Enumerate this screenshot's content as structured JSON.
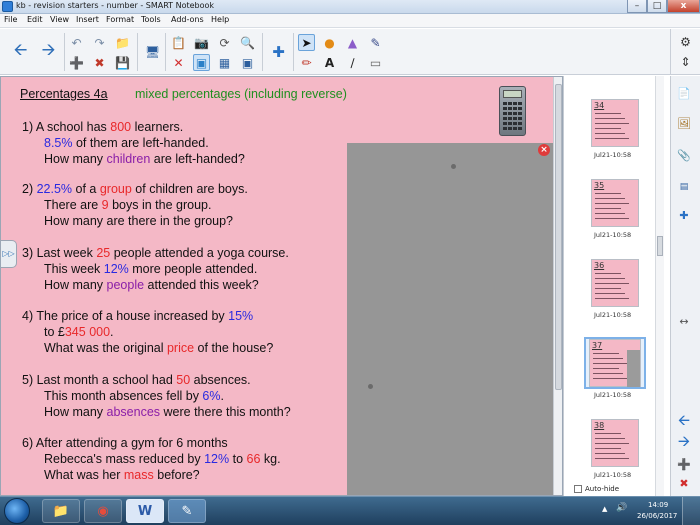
{
  "window": {
    "title": "kb - revision starters - number - SMART Notebook",
    "min_label": "–",
    "max_label": "□",
    "close_label": "x"
  },
  "menu": [
    "File",
    "Edit",
    "View",
    "Insert",
    "Format",
    "Tools",
    "Add-ons",
    "Help"
  ],
  "page": {
    "heading": "Percentages 4a",
    "subheading": "mixed percentages (including reverse)",
    "questions": [
      {
        "lines": [
          [
            {
              "t": "1)  A school has ",
              "c": ""
            },
            {
              "t": "800",
              "c": "red"
            },
            {
              "t": " learners.",
              "c": ""
            }
          ],
          [
            {
              "t": "8.5%",
              "c": "blue"
            },
            {
              "t": " of them are left-handed.",
              "c": ""
            }
          ],
          [
            {
              "t": "How many ",
              "c": ""
            },
            {
              "t": "children",
              "c": "purple"
            },
            {
              "t": " are left-handed?",
              "c": ""
            }
          ]
        ]
      },
      {
        "lines": [
          [
            {
              "t": "2)  ",
              "c": ""
            },
            {
              "t": "22.5%",
              "c": "blue"
            },
            {
              "t": " of a ",
              "c": ""
            },
            {
              "t": "group",
              "c": "red"
            },
            {
              "t": " of children are boys.",
              "c": ""
            }
          ],
          [
            {
              "t": "There are ",
              "c": ""
            },
            {
              "t": "9",
              "c": "red"
            },
            {
              "t": " boys in the group.",
              "c": ""
            }
          ],
          [
            {
              "t": "How many are there in the group?",
              "c": ""
            }
          ]
        ]
      },
      {
        "lines": [
          [
            {
              "t": "3)  Last week ",
              "c": ""
            },
            {
              "t": "25",
              "c": "red"
            },
            {
              "t": " people attended a yoga course.",
              "c": ""
            }
          ],
          [
            {
              "t": "This week ",
              "c": ""
            },
            {
              "t": "12%",
              "c": "blue"
            },
            {
              "t": " more people attended.",
              "c": ""
            }
          ],
          [
            {
              "t": "How many ",
              "c": ""
            },
            {
              "t": "people",
              "c": "purple"
            },
            {
              "t": " attended this week?",
              "c": ""
            }
          ]
        ]
      },
      {
        "lines": [
          [
            {
              "t": "4)  The price of a house increased by ",
              "c": ""
            },
            {
              "t": "15%",
              "c": "blue"
            }
          ],
          [
            {
              "t": "to £",
              "c": ""
            },
            {
              "t": "345 000",
              "c": "red"
            },
            {
              "t": ".",
              "c": ""
            }
          ],
          [
            {
              "t": "What was the original ",
              "c": ""
            },
            {
              "t": "price",
              "c": "red"
            },
            {
              "t": " of the house?",
              "c": ""
            }
          ]
        ]
      },
      {
        "lines": [
          [
            {
              "t": "5)  Last month a school had ",
              "c": ""
            },
            {
              "t": "50",
              "c": "red"
            },
            {
              "t": " absences.",
              "c": ""
            }
          ],
          [
            {
              "t": "This month absences fell by ",
              "c": ""
            },
            {
              "t": "6%",
              "c": "blue"
            },
            {
              "t": ".",
              "c": ""
            }
          ],
          [
            {
              "t": "How many ",
              "c": ""
            },
            {
              "t": "absences",
              "c": "purple"
            },
            {
              "t": " were there this month?",
              "c": ""
            }
          ]
        ]
      },
      {
        "lines": [
          [
            {
              "t": "6)  After attending a gym for 6 months",
              "c": ""
            }
          ],
          [
            {
              "t": "Rebecca's mass reduced by ",
              "c": ""
            },
            {
              "t": "12%",
              "c": "blue"
            },
            {
              "t": " to ",
              "c": ""
            },
            {
              "t": "66",
              "c": "red"
            },
            {
              "t": " kg.",
              "c": ""
            }
          ],
          [
            {
              "t": "What was her ",
              "c": ""
            },
            {
              "t": "mass",
              "c": "red"
            },
            {
              "t": " before?",
              "c": ""
            }
          ]
        ]
      }
    ]
  },
  "sorter": {
    "pages": [
      {
        "num": "34",
        "time": "Jul21-10:58",
        "selected": false
      },
      {
        "num": "35",
        "time": "Jul21-10:58",
        "selected": false
      },
      {
        "num": "36",
        "time": "Jul21-10:58",
        "selected": false
      },
      {
        "num": "37",
        "time": "Jul21-10:58",
        "selected": true
      },
      {
        "num": "38",
        "time": "Jul21-10:58",
        "selected": false
      }
    ],
    "autohide": "Auto-hide"
  },
  "taskbar": {
    "time": "14:09",
    "date": "26/06/2017"
  },
  "colors": {
    "page_bg": "#f4b8c6",
    "red": "#e8282a",
    "blue": "#2a2ae0",
    "purple": "#8a1fa8",
    "green": "#1f8f1f"
  }
}
